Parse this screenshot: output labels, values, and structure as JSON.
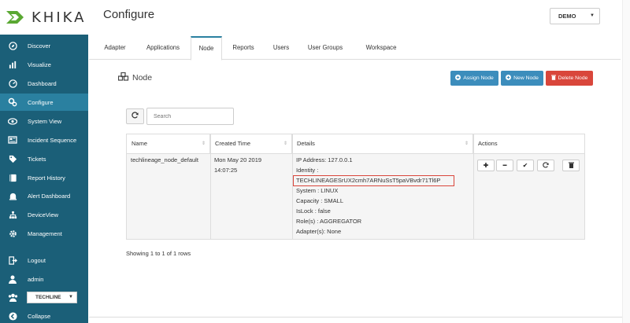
{
  "brand": {
    "logo_text": "KHIKA"
  },
  "sidebar": {
    "items": [
      {
        "label": "Discover",
        "icon": "compass-icon"
      },
      {
        "label": "Visualize",
        "icon": "bar-chart-icon"
      },
      {
        "label": "Dashboard",
        "icon": "dashboard-icon"
      },
      {
        "label": "Configure",
        "icon": "gears-icon"
      },
      {
        "label": "System View",
        "icon": "eye-icon"
      },
      {
        "label": "Incident Sequence",
        "icon": "newspaper-icon"
      },
      {
        "label": "Tickets",
        "icon": "tag-icon"
      },
      {
        "label": "Report History",
        "icon": "book-icon"
      },
      {
        "label": "Alert Dashboard",
        "icon": "alarm-icon"
      },
      {
        "label": "DeviceView",
        "icon": "sitemap-icon"
      },
      {
        "label": "Management",
        "icon": "gear-icon"
      }
    ],
    "logout_label": "Logout",
    "user_label": "admin",
    "org_selected": "TECHLINE",
    "collapse_label": "Collapse"
  },
  "header": {
    "title": "Configure",
    "workspace_selected": "DEMO"
  },
  "tabs": [
    {
      "label": "Adapter"
    },
    {
      "label": "Applications"
    },
    {
      "label": "Node"
    },
    {
      "label": "Reports"
    },
    {
      "label": "Users"
    },
    {
      "label": "User Groups"
    },
    {
      "label": "Workspace"
    }
  ],
  "panel": {
    "title": "Node",
    "assign_label": "Assign Node",
    "new_label": "New Node",
    "delete_label": "Delete Node",
    "search_placeholder": "Search"
  },
  "table": {
    "columns": [
      "Name",
      "Created Time",
      "Details",
      "Actions"
    ],
    "rows": [
      {
        "name": "techlineage_node_default",
        "created_date": "Mon May 20 2019",
        "created_time": "14:07:25",
        "details": {
          "ip": "IP Address: 127.0.0.1",
          "identity_label": "Identity :",
          "identity_value": "TECHLINEAGESrUX2cmh7ARNuSsT5paVBvdr71Tl6P",
          "system": "System : LINUX",
          "capacity": "Capacity : SMALL",
          "islock": "IsLock : false",
          "roles": "Role(s) : AGGREGATOR",
          "adapters": "Adapter(s): None"
        }
      }
    ],
    "showing_text": "Showing 1 to 1 of 1 rows"
  },
  "colors": {
    "sidebar": "#1b5f78",
    "sidebar_active": "#2a80a0",
    "primary_button": "#3c8dbc",
    "danger_button": "#d9463b"
  }
}
